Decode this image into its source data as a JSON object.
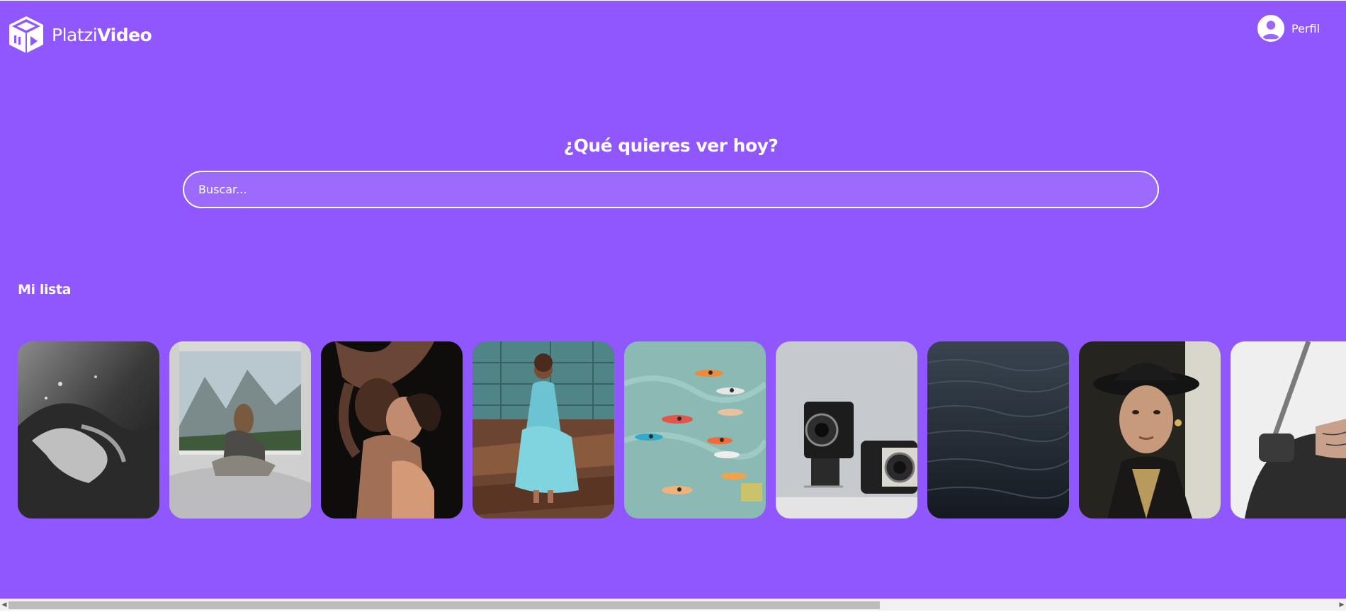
{
  "header": {
    "logo": {
      "brand_light": "Platzi",
      "brand_bold": "Video",
      "icon": "cube-play-icon"
    },
    "profile": {
      "label": "Perfil",
      "icon": "user-avatar-icon"
    }
  },
  "search": {
    "title": "¿Qué quieres ver hoy?",
    "placeholder": "Buscar..."
  },
  "categories": [
    {
      "title": "Mi lista",
      "items": [
        {
          "description": "wave"
        },
        {
          "description": "van-mountains"
        },
        {
          "description": "couple"
        },
        {
          "description": "woman-blue-dress"
        },
        {
          "description": "surfboards-water"
        },
        {
          "description": "vintage-cameras"
        },
        {
          "description": "dark-water"
        },
        {
          "description": "woman-hat"
        },
        {
          "description": "motorcycle-hand"
        }
      ]
    }
  ],
  "colors": {
    "background": "#8f57fd",
    "text": "#ffffff"
  }
}
